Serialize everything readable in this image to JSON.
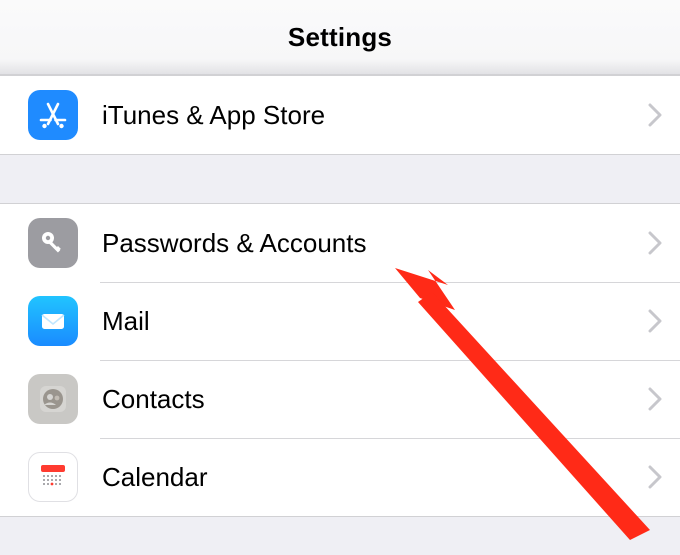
{
  "header": {
    "title": "Settings"
  },
  "groups": [
    {
      "items": [
        {
          "key": "itunes",
          "label": "iTunes & App Store",
          "icon": "appstore-icon",
          "icon_bg": "#1f8bff"
        }
      ]
    },
    {
      "items": [
        {
          "key": "passwords",
          "label": "Passwords & Accounts",
          "icon": "key-icon",
          "icon_bg": "#9c9ca1"
        },
        {
          "key": "mail",
          "label": "Mail",
          "icon": "mail-icon",
          "icon_bg": "#1fa8ff"
        },
        {
          "key": "contacts",
          "label": "Contacts",
          "icon": "contacts-icon",
          "icon_bg": "#bdbdbb"
        },
        {
          "key": "calendar",
          "label": "Calendar",
          "icon": "calendar-icon",
          "icon_bg": "#ffffff"
        }
      ]
    }
  ],
  "annotation": {
    "target": "passwords",
    "color": "#ff2a17"
  }
}
